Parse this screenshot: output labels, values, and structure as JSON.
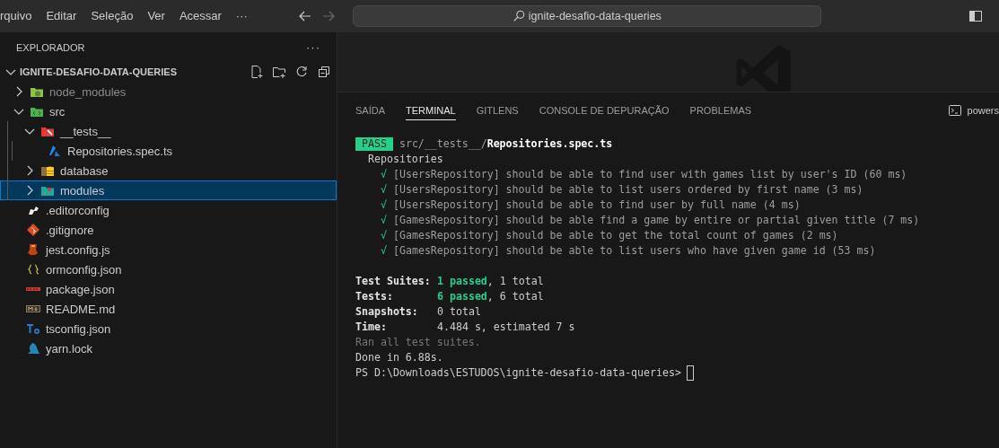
{
  "menu_bar": {
    "items": [
      "rquivo",
      "Editar",
      "Seleção",
      "Ver",
      "Acessar",
      "···"
    ],
    "command_center": "ignite-desafio-data-queries"
  },
  "sidebar": {
    "title": "EXPLORADOR",
    "more": "···",
    "root": {
      "label": "IGNITE-DESAFIO-DATA-QUERIES",
      "expanded": true
    },
    "items": [
      {
        "label": "node_modules",
        "kind": "node-folder",
        "expanded": false,
        "dimmed": true,
        "selected": false
      },
      {
        "label": "src",
        "kind": "src-folder",
        "expanded": true,
        "dimmed": false,
        "selected": false,
        "children": [
          {
            "label": "__tests__",
            "kind": "tests-folder",
            "expanded": true,
            "dimmed": false,
            "selected": false,
            "children": [
              {
                "label": "Repositories.spec.ts",
                "kind": "test-file",
                "dimmed": false,
                "selected": false
              }
            ]
          },
          {
            "label": "database",
            "kind": "db-folder",
            "expanded": false,
            "dimmed": false,
            "selected": false
          },
          {
            "label": "modules",
            "kind": "modules-folder",
            "expanded": false,
            "dimmed": false,
            "selected": true
          }
        ]
      },
      {
        "label": ".editorconfig",
        "kind": "editorconfig",
        "dimmed": false,
        "selected": false
      },
      {
        "label": ".gitignore",
        "kind": "git",
        "dimmed": false,
        "selected": false
      },
      {
        "label": "jest.config.js",
        "kind": "jest",
        "dimmed": false,
        "selected": false
      },
      {
        "label": "ormconfig.json",
        "kind": "json",
        "dimmed": false,
        "selected": false
      },
      {
        "label": "package.json",
        "kind": "npm",
        "dimmed": false,
        "selected": false
      },
      {
        "label": "README.md",
        "kind": "markdown",
        "dimmed": false,
        "selected": false
      },
      {
        "label": "tsconfig.json",
        "kind": "ts",
        "dimmed": false,
        "selected": false
      },
      {
        "label": "yarn.lock",
        "kind": "yarn",
        "dimmed": false,
        "selected": false
      }
    ]
  },
  "panel": {
    "tabs": [
      {
        "label": "SAÍDA",
        "selected": false
      },
      {
        "label": "TERMINAL",
        "selected": true
      },
      {
        "label": "GITLENS",
        "selected": false
      },
      {
        "label": "CONSOLE DE DEPURAÇÃO",
        "selected": false
      },
      {
        "label": "PROBLEMAS",
        "selected": false
      }
    ],
    "terminal_name": "powers",
    "terminal": {
      "status": "PASS",
      "path_dir": "src/__tests__/",
      "file": "Repositories.spec.ts",
      "suite": "Repositories",
      "tests": [
        {
          "mark": "√",
          "name": "[UsersRepository] should be able to find user with games list by user's ID (60 ms)"
        },
        {
          "mark": "√",
          "name": "[UsersRepository] should be able to list users ordered by first name (3 ms)"
        },
        {
          "mark": "√",
          "name": "[UsersRepository] should be able to find user by full name (4 ms)"
        },
        {
          "mark": "√",
          "name": "[GamesRepository] should be able find a game by entire or partial given title (7 ms)"
        },
        {
          "mark": "√",
          "name": "[GamesRepository] should be able to get the total count of games (2 ms)"
        },
        {
          "mark": "√",
          "name": "[GamesRepository] should be able to list users who have given game id (53 ms)"
        }
      ],
      "summary": [
        {
          "label": "Test Suites:",
          "passed": "1 passed",
          "rest": ", 1 total"
        },
        {
          "label": "Tests:",
          "passed": "6 passed",
          "rest": ", 6 total"
        },
        {
          "label": "Snapshots:",
          "rest": "0 total"
        },
        {
          "label": "Time:",
          "rest": "4.484 s, estimated 7 s"
        }
      ],
      "note": "Ran all test suites.",
      "done": "Done in 6.88s.",
      "prompt": "PS D:\\Downloads\\ESTUDOS\\ignite-desafio-data-queries>"
    }
  }
}
